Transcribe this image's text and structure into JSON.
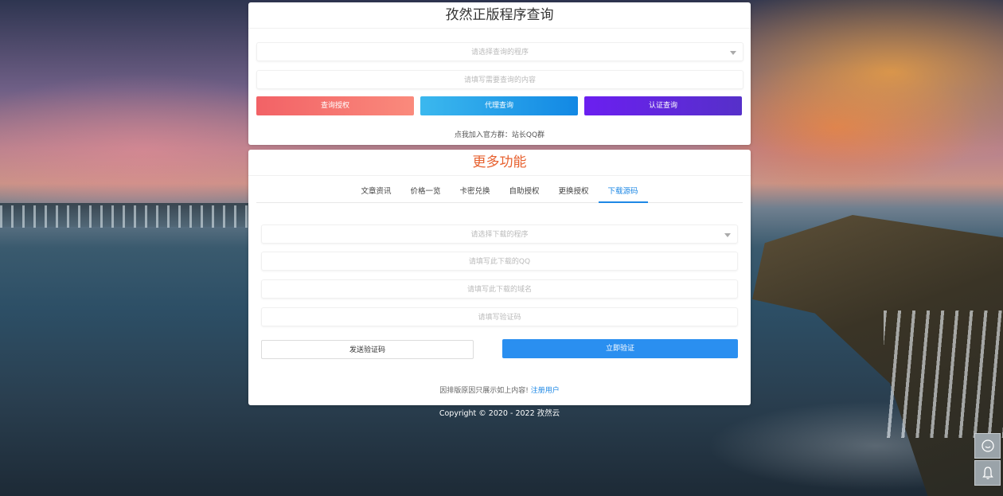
{
  "query": {
    "title": "孜然正版程序查询",
    "select_placeholder": "请选择查询的程序",
    "input_placeholder": "请填写需要查询的内容",
    "buttons": {
      "auth": "查询授权",
      "agent": "代理查询",
      "cert": "认证查询"
    },
    "group_hint": "点我加入官方群：站长QQ群"
  },
  "more": {
    "title": "更多功能",
    "tabs": [
      "文章资讯",
      "价格一览",
      "卡密兑换",
      "自助授权",
      "更换授权",
      "下载源码"
    ],
    "active_tab": "下载源码",
    "form": {
      "select_placeholder": "请选择下载的程序",
      "qq_placeholder": "请填写此下载的QQ",
      "domain_placeholder": "请填写此下载的域名",
      "code_placeholder": "请填写验证码"
    },
    "send_code": "发送验证码",
    "verify": "立即验证",
    "footer_text": "因排版原因只展示如上内容!",
    "register_link": "注册用户"
  },
  "copyright": "Copyright © 2020 - 2022 孜然云",
  "side": {
    "chat_icon": "chat-icon",
    "bell_icon": "bell-icon"
  },
  "colors": {
    "accent_blue": "#1e88e5",
    "title_orange": "#e7612f",
    "red": "#f26266",
    "purple": "#6b1ff0"
  }
}
